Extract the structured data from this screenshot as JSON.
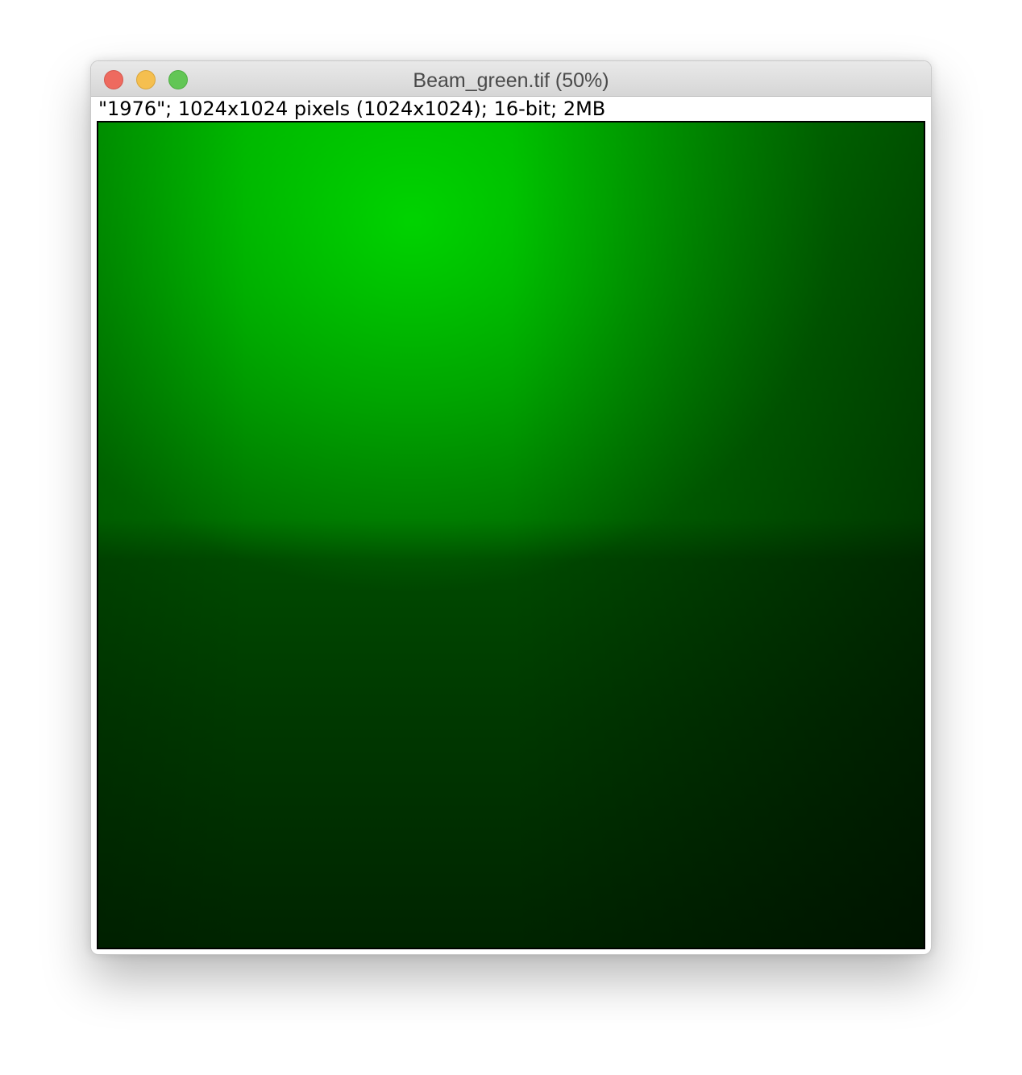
{
  "window": {
    "title": "Beam_green.tif (50%)",
    "controls": {
      "close": "close-button",
      "minimize": "minimize-button",
      "zoom": "zoom-button"
    }
  },
  "image_info": {
    "text": "\"1976\"; 1024x1024 pixels (1024x1024); 16-bit; 2MB"
  },
  "image": {
    "channel_color": "#00b000",
    "dark_color": "#001400"
  }
}
